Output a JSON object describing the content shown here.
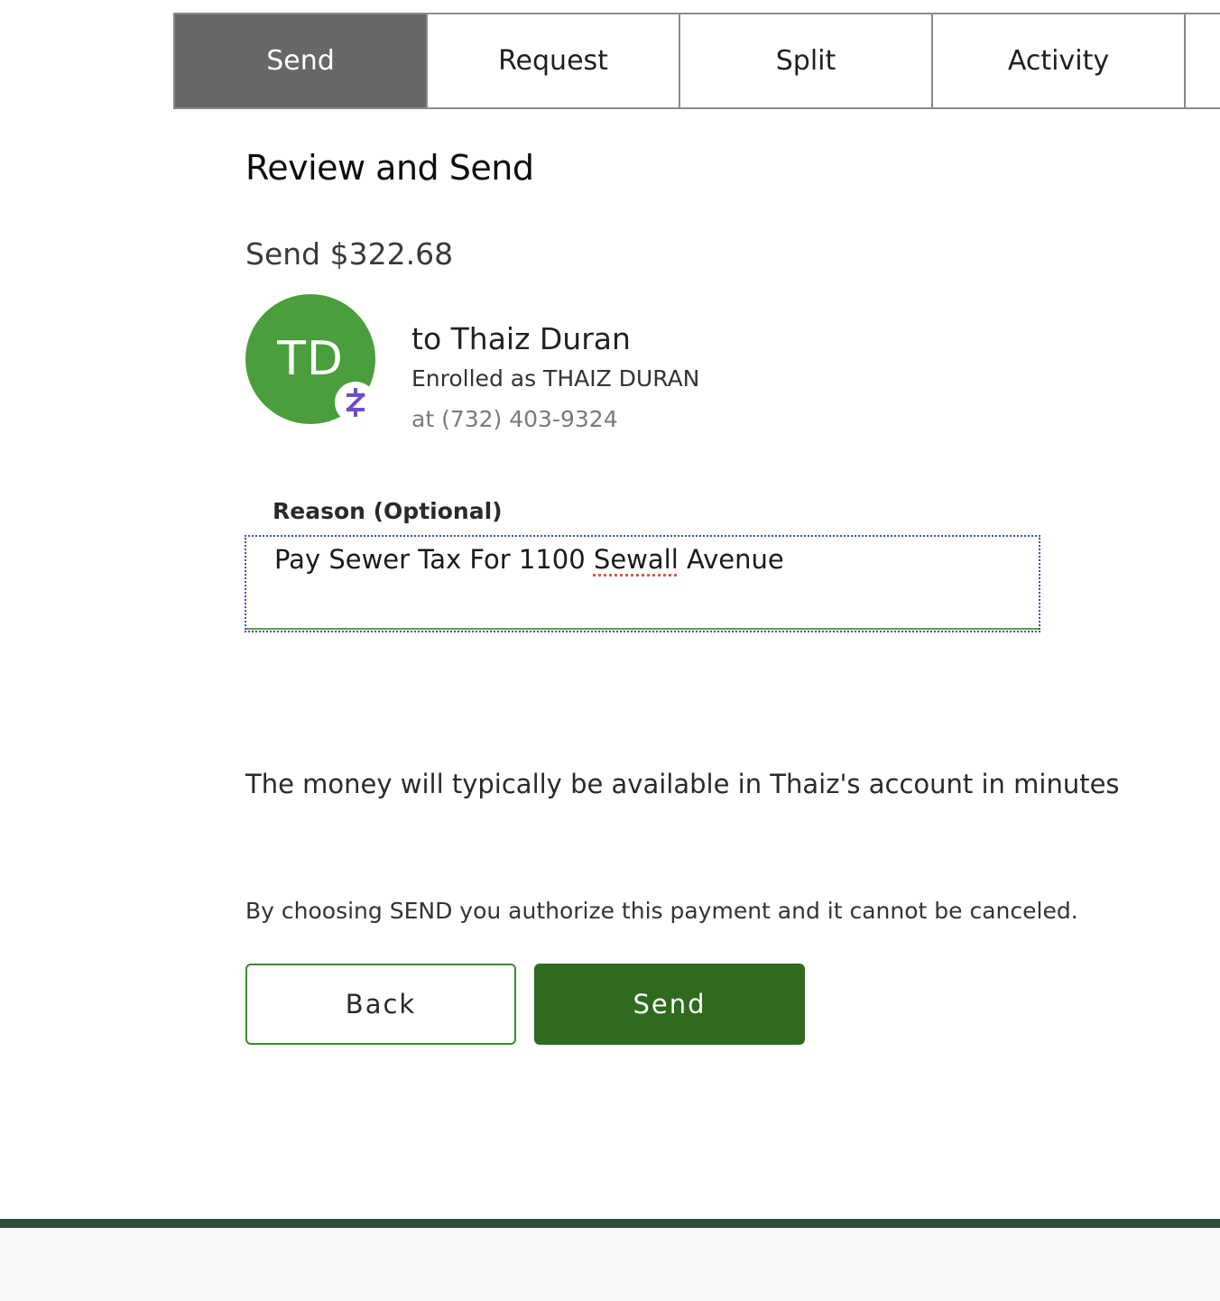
{
  "tabs": [
    {
      "label": "Send",
      "active": true
    },
    {
      "label": "Request",
      "active": false
    },
    {
      "label": "Split",
      "active": false
    },
    {
      "label": "Activity",
      "active": false
    }
  ],
  "page": {
    "title": "Review and Send"
  },
  "payment": {
    "action": "Send",
    "amount": "$322.68"
  },
  "recipient": {
    "initials": "TD",
    "name_line": "to Thaiz Duran",
    "enrolled_line": "Enrolled as THAIZ DURAN",
    "phone_line": "at (732) 403-9324",
    "badge_icon": "zelle-icon",
    "avatar_color": "#4a9e3c"
  },
  "reason": {
    "label": "Reason (Optional)",
    "value_before": "Pay Sewer Tax For 1100 ",
    "value_misspelled": "Sewall",
    "value_after": " Avenue"
  },
  "messages": {
    "availability": "The money will typically be available in Thaiz's account in minutes",
    "authorize": "By choosing SEND you authorize this payment and it cannot be canceled."
  },
  "buttons": {
    "back_label": "Back",
    "send_label": "Send"
  },
  "colors": {
    "primary_green": "#2e6b1f",
    "tab_active": "#676767",
    "footer_bar": "#2b4d37",
    "zelle_purple": "#6d1ed4"
  }
}
